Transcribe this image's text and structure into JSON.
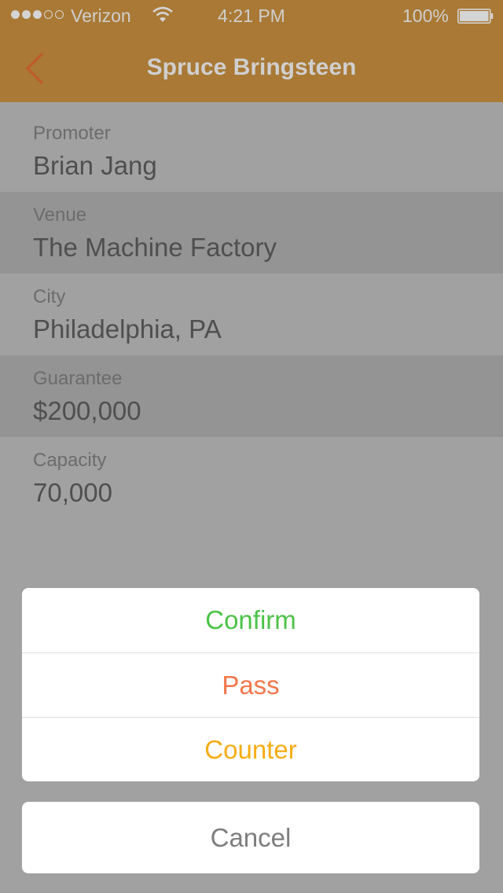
{
  "status_bar": {
    "carrier": "Verizon",
    "time": "4:21 PM",
    "battery": "100%",
    "signal_bars": 3,
    "signal_total": 5,
    "battery_level": 1.0
  },
  "nav": {
    "title": "Spruce Bringsteen",
    "back_icon": "chevron-left-icon"
  },
  "details": [
    {
      "label": "Promoter",
      "value": "Brian Jang"
    },
    {
      "label": "Venue",
      "value": "The Machine Factory"
    },
    {
      "label": "City",
      "value": "Philadelphia, PA"
    },
    {
      "label": "Guarantee",
      "value": "$200,000"
    },
    {
      "label": "Capacity",
      "value": "70,000"
    }
  ],
  "actions": {
    "confirm": "Confirm",
    "pass": "Pass",
    "counter": "Counter",
    "cancel": "Cancel"
  },
  "colors": {
    "header_bg": "#a97935",
    "back_chevron": "#c15a2a",
    "confirm": "#4cc247",
    "pass": "#f0774a",
    "counter": "#f5ad13",
    "cancel": "#7e7e7e"
  }
}
